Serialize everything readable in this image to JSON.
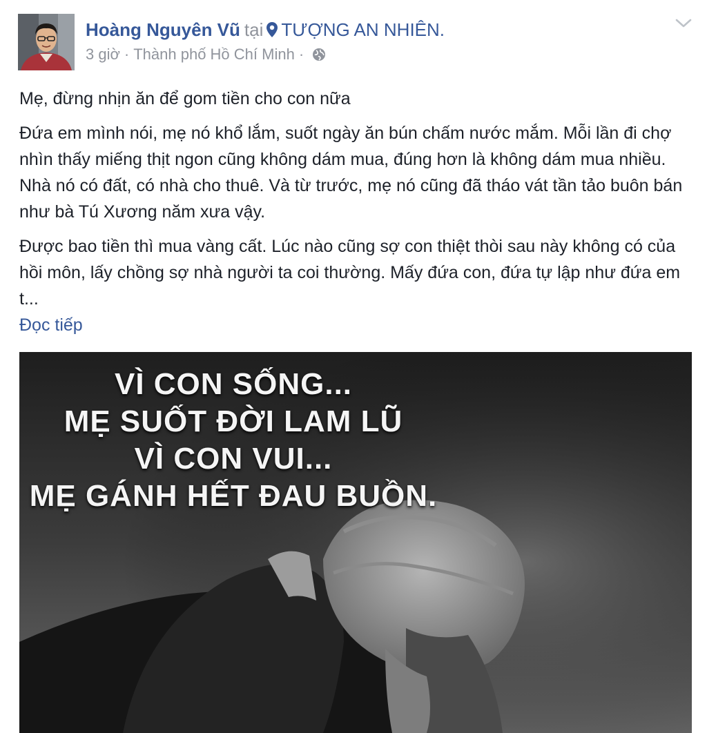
{
  "post": {
    "author": "Hoàng Nguyên Vũ",
    "at_word": "tại",
    "place": "TƯỢNG AN NHIÊN.",
    "time": "3 giờ",
    "separator": "·",
    "location": "Thành phố Hồ Chí Minh",
    "privacy_icon": "globe-icon",
    "options_icon": "chevron-down-icon",
    "paragraphs": [
      "Mẹ, đừng nhịn ăn để gom tiền cho con nữa",
      "Đứa em mình nói, mẹ nó khổ lắm, suốt ngày ăn bún chấm nước mắm. Mỗi lần đi chợ nhìn thấy miếng thịt ngon cũng không dám mua, đúng hơn là không dám mua nhiều. Nhà nó có đất, có nhà cho thuê. Và từ trước, mẹ nó cũng đã tháo vát tần tảo buôn bán như bà Tú Xương năm xưa vậy.",
      "Được bao tiền thì mua vàng cất. Lúc nào cũng sợ con thiệt thòi sau này không có của hồi môn, lấy chồng sợ nhà người ta coi thường. Mấy đứa con, đứa tự lập như đứa em t..."
    ],
    "see_more": "Đọc tiếp",
    "image_caption": [
      "VÌ CON SỐNG...",
      "MẸ SUỐT ĐỜI LAM LŨ",
      "VÌ CON VUI...",
      "MẸ GÁNH HẾT ĐAU BUỒN."
    ]
  },
  "colors": {
    "link": "#365899",
    "secondary_text": "#90949c",
    "body_text": "#1d2129"
  }
}
